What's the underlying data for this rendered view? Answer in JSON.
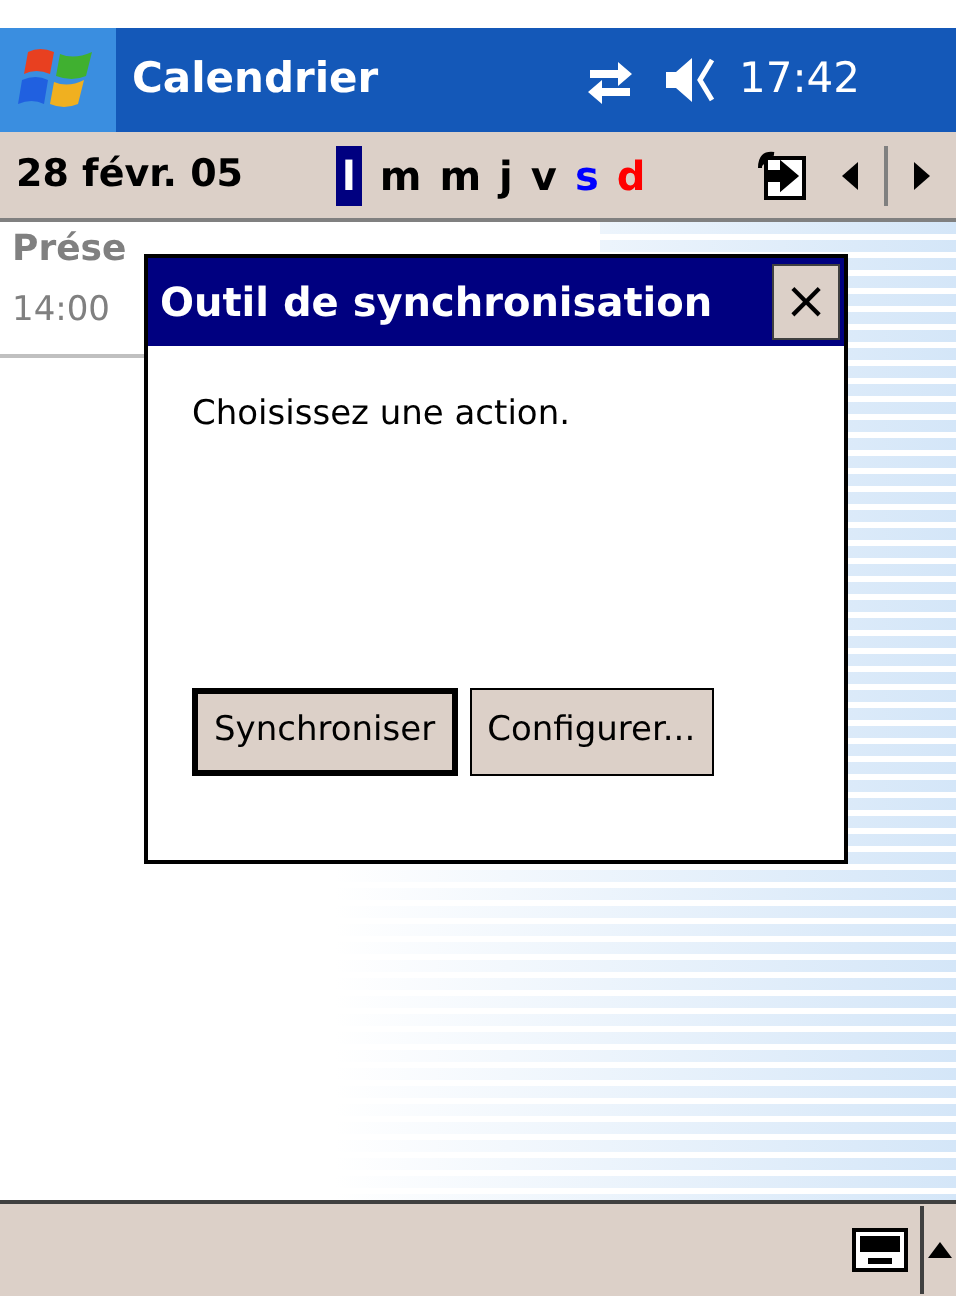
{
  "title_bar": {
    "title": "Calendrier",
    "time": "17:42"
  },
  "toolbar": {
    "date": "28 févr. 05",
    "days": [
      {
        "label": "l",
        "selected": true
      },
      {
        "label": "m",
        "selected": false
      },
      {
        "label": "m",
        "selected": false
      },
      {
        "label": "j",
        "selected": false
      },
      {
        "label": "v",
        "selected": false
      },
      {
        "label": "s",
        "selected": false,
        "color": "#0000ff"
      },
      {
        "label": "d",
        "selected": false,
        "color": "#ff0000"
      }
    ]
  },
  "appointment": {
    "title": "Prése",
    "time": "14:00"
  },
  "dialog": {
    "title": "Outil de synchronisation",
    "close": "×",
    "message": "Choisissez une action.",
    "buttons": [
      {
        "label": "Synchroniser",
        "default": true
      },
      {
        "label": "Configurer...",
        "default": false
      }
    ]
  }
}
